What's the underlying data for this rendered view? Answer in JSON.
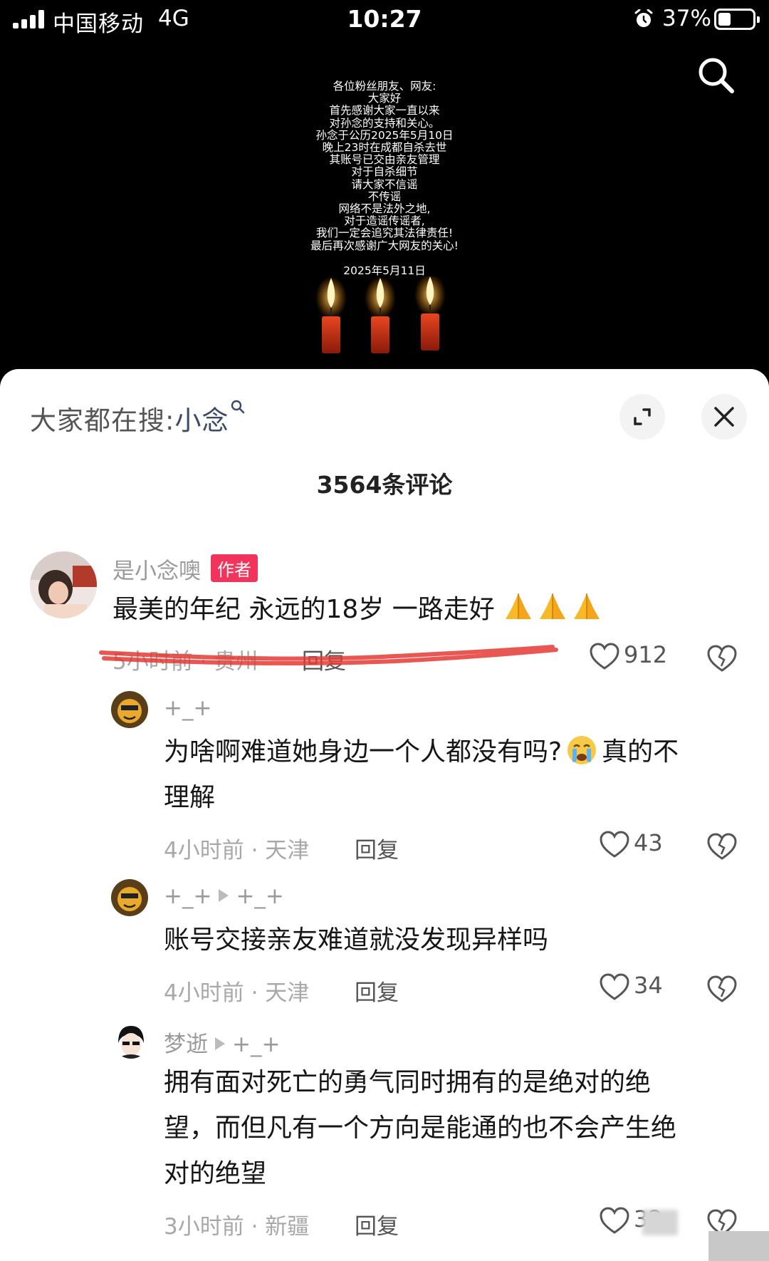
{
  "status_bar": {
    "carrier": "中国移动",
    "network": "4G",
    "time": "10:27",
    "battery_percent": "37%",
    "battery_level": 0.37,
    "icons": [
      "signal-icon",
      "alarm-icon",
      "battery-icon"
    ]
  },
  "video": {
    "notice_lines": [
      "各位粉丝朋友、网友:",
      "大家好",
      "首先感谢大家一直以来",
      "对孙念的支持和关心。",
      "孙念于公历2025年5月10日",
      "晚上23时在成都自杀去世",
      "其账号已交由亲友管理",
      "对于自杀细节",
      "请大家不信谣",
      "不传谣",
      "网络不是法外之地,",
      "对于造谣传谣者,",
      "我们一定会追究其法律责任!",
      "最后再次感谢广大网友的关心!"
    ],
    "notice_date": "2025年5月11日",
    "search_icon": "search-icon"
  },
  "panel": {
    "trending_prefix": "大家都在搜:",
    "trending_keyword": "小念",
    "comment_count": "3564条评论",
    "colors": {
      "author_badge": "#f2335b",
      "scribble": "#e53935"
    }
  },
  "comments": [
    {
      "username": "是小念噢",
      "badge": "作者",
      "text": "最美的年纪 永远的18岁 一路走好",
      "meta": "5小时前 · 贵州",
      "reply": "回复",
      "likes": "912"
    },
    {
      "username": "+_+",
      "text_a": "为啥啊难道她身边一个人都没有吗?",
      "text_b": "真的不",
      "text_c": "理解",
      "meta": "4小时前 · 天津",
      "reply": "回复",
      "likes": "43"
    },
    {
      "username": "+_+",
      "reply_to": "+_+",
      "text": "账号交接亲友难道就没发现异样吗",
      "meta": "4小时前 · 天津",
      "reply": "回复",
      "likes": "34"
    },
    {
      "username": "梦逝",
      "reply_to": "+_+",
      "text_lines": [
        "拥有面对死亡的勇气同时拥有的是绝对的绝",
        "望，而但凡有一个方向是能通的也不会产生绝",
        "对的绝望"
      ],
      "meta": "3小时前 · 新疆",
      "reply": "回复",
      "likes": "32"
    }
  ]
}
